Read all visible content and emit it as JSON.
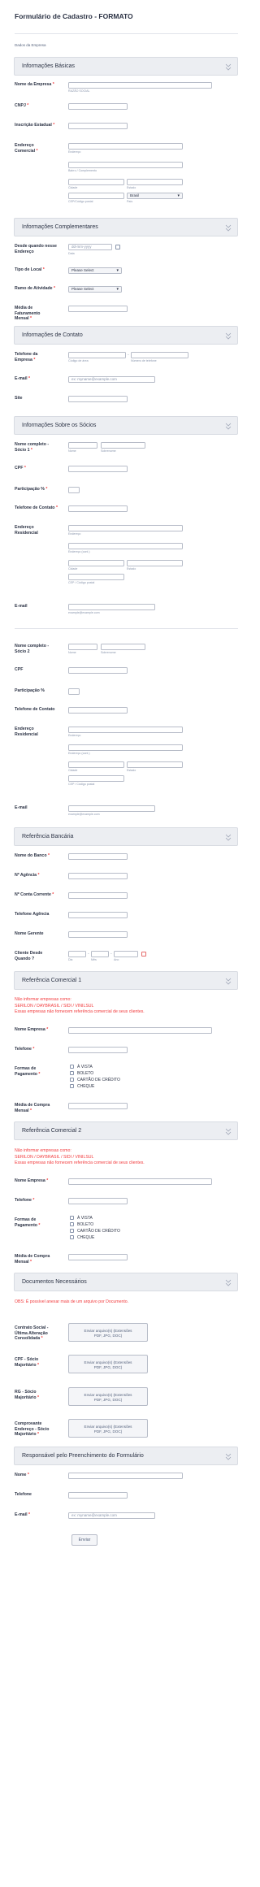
{
  "form": {
    "title": "Formulário de Cadastro - FORMATO",
    "subtitle": "Dados da Empresa"
  },
  "sections": {
    "basic": "Informações Básicas",
    "complementary": "Informações Complementares",
    "contact": "Informações de Contato",
    "partners": "Informações Sobre os Sócios",
    "bank": "Referência Bancária",
    "ref1": "Referência Comercial 1",
    "ref2": "Referência Comercial 2",
    "docs": "Documentos Necessários",
    "responsible": "Responsável pelo Preenchimento do Formulário"
  },
  "basic": {
    "company_name": "Nome da Empresa",
    "company_name_sub": "RAZÃO SOCIAL",
    "cnpj": "CNPJ",
    "state_reg": "Inscrição Estadual",
    "address_1": "Endereço",
    "address_2": "Comercial",
    "sub_address": "Endereço",
    "sub_district": "Bairro / Complemento",
    "sub_city": "Cidade",
    "sub_state": "Estado",
    "country_value": "Brasil",
    "sub_zip": "CEP/Código postal",
    "sub_country": "País"
  },
  "complementary": {
    "since_1": "Desde quando nesse",
    "since_2": "Endereço",
    "since_placeholder": "dd-mm-yyyy",
    "since_sub": "Data",
    "place_type": "Tipo de Local",
    "place_type_value": "Please Select",
    "activity": "Ramo de Atividade",
    "activity_value": "Please Select",
    "revenue_1": "Média de",
    "revenue_2": "Faturamento",
    "revenue_3": "Mensal"
  },
  "contact": {
    "phone_1": "Telefone da",
    "phone_2": "Empresa",
    "sub_area": "Código de área",
    "sub_number": "Número de telefone",
    "email": "E-mail",
    "email_placeholder": "ex: myname@example.com",
    "site": "Site"
  },
  "partner1": {
    "name_1": "Nome completo -",
    "name_2": "Sócio 1",
    "sub_first": "Nome",
    "sub_last": "Sobrenome",
    "cpf": "CPF",
    "share": "Participação %",
    "phone": "Telefone de Contato",
    "address_1": "Endereço",
    "address_2": "Residencial",
    "sub_address": "Endereço",
    "sub_address2": "Endereço (cont.)",
    "sub_city": "Cidade",
    "sub_state": "Estado",
    "sub_zip": "CEP / Código postal",
    "email": "E-mail",
    "email_sub": "example@example.com"
  },
  "partner2": {
    "name_1": "Nome completo -",
    "name_2": "Sócio 2",
    "sub_first": "Nome",
    "sub_last": "Sobrenome",
    "cpf": "CPF",
    "share": "Participação %",
    "phone": "Telefone de Contato",
    "address_1": "Endereço",
    "address_2": "Residencial",
    "sub_address": "Endereço",
    "sub_address2": "Endereço (cont.)",
    "sub_city": "Cidade",
    "sub_state": "Estado",
    "sub_zip": "CEP / Código postal",
    "email": "E-mail",
    "email_sub": "example@example.com"
  },
  "bank": {
    "bank_name": "Nome do Banco",
    "agency": "Nº Agência",
    "account": "Nº Conta Corrente",
    "agency_phone": "Telefone Agência",
    "manager": "Nome Gerente",
    "since_1": "Cliente Desde",
    "since_2": "Quando ?",
    "sub_day": "Dia",
    "sub_month": "Mês",
    "sub_year": "Ano"
  },
  "ref1": {
    "warn_1": "Não informar empresas como:",
    "warn_2": "SERILON / DAYBRASIL / SIDI / VINILSUL",
    "warn_3": "Essas empresas não fornecem referência comercial de seus clientes.",
    "company": "Nome Empresa",
    "phone": "Telefone",
    "payment_1": "Formas de",
    "payment_2": "Pagamento",
    "opt_1": "À VISTA",
    "opt_2": "BOLETO",
    "opt_3": "CARTÃO DE CRÉDITO",
    "opt_4": "CHEQUE",
    "avg_1": "Média de Compra",
    "avg_2": "Mensal"
  },
  "ref2": {
    "warn_1": "Não informar empresas como:",
    "warn_2": "SERILON / DAYBRASIL / SIDI / VINILSUL",
    "warn_3": "Essas empresas não fornecem referência comercial de seus clientes.",
    "company": "Nome Empresa",
    "phone": "Telefone",
    "payment_1": "Formas de",
    "payment_2": "Pagamento",
    "opt_1": "À VISTA",
    "opt_2": "BOLETO",
    "opt_3": "CARTÃO DE CRÉDITO",
    "opt_4": "CHEQUE",
    "avg_1": "Média de Compra",
    "avg_2": "Mensal"
  },
  "docs": {
    "note": "OBS: É possível anexar mais de um arquivo por Documento.",
    "contract_1": "Contrato Social -",
    "contract_2": "Última Alteração",
    "contract_3": "Consolidada",
    "cpf_1": "CPF - Sócio",
    "cpf_2": "Majoritário",
    "rg_1": "RG - Sócio",
    "rg_2": "Majoritário",
    "proof_1": "Comprovante",
    "proof_2": "Endereço - Sócio",
    "proof_3": "Majoritário",
    "upload_1": "Enviar arquivo(s) (Extensões",
    "upload_2": "PDF, JPG, DOC)"
  },
  "responsible": {
    "name": "Nome",
    "phone": "Telefone",
    "email": "E-mail",
    "email_placeholder": "ex: myname@example.com",
    "submit": "Enviar"
  },
  "colors": {
    "required": "#f23a3c",
    "section_bg": "#eceef2",
    "warning_text": "#f23a3c"
  }
}
